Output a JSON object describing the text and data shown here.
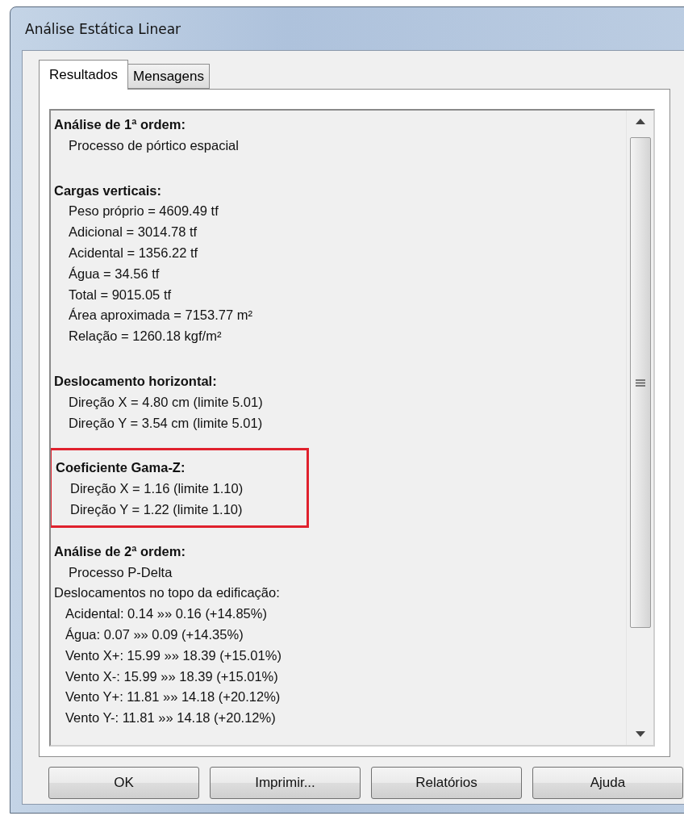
{
  "window": {
    "title": "Análise Estática Linear"
  },
  "tabs": [
    {
      "label": "Resultados",
      "selected": true
    },
    {
      "label": "Mensagens",
      "selected": false
    }
  ],
  "results": {
    "sections": [
      {
        "highlighted": false,
        "lines": [
          {
            "kind": "heading",
            "text": "Análise de 1ª ordem:"
          },
          {
            "kind": "item",
            "text": "Processo de pórtico espacial"
          }
        ]
      },
      {
        "highlighted": false,
        "lines": [
          {
            "kind": "heading",
            "text": "Cargas verticais:"
          },
          {
            "kind": "item",
            "text": "Peso próprio = 4609.49 tf"
          },
          {
            "kind": "item",
            "text": "Adicional = 3014.78 tf"
          },
          {
            "kind": "item",
            "text": "Acidental = 1356.22 tf"
          },
          {
            "kind": "item",
            "text": "Água = 34.56 tf"
          },
          {
            "kind": "item",
            "text": "Total = 9015.05 tf"
          },
          {
            "kind": "item",
            "text": "Área aproximada = 7153.77 m²"
          },
          {
            "kind": "item",
            "text": "Relação = 1260.18 kgf/m²"
          }
        ]
      },
      {
        "highlighted": false,
        "lines": [
          {
            "kind": "heading",
            "text": "Deslocamento horizontal:"
          },
          {
            "kind": "item",
            "text": "Direção X = 4.80 cm (limite 5.01)"
          },
          {
            "kind": "item",
            "text": "Direção Y = 3.54 cm (limite 5.01)"
          }
        ]
      },
      {
        "highlighted": true,
        "lines": [
          {
            "kind": "heading",
            "text": "Coeficiente Gama-Z:"
          },
          {
            "kind": "item",
            "text": "Direção X = 1.16 (limite 1.10)"
          },
          {
            "kind": "item",
            "text": "Direção Y = 1.22 (limite 1.10)"
          }
        ]
      },
      {
        "highlighted": false,
        "lines": [
          {
            "kind": "heading",
            "text": "Análise de 2ª ordem:"
          },
          {
            "kind": "item",
            "text": "Processo P-Delta"
          },
          {
            "kind": "plain",
            "text": "Deslocamentos no topo da edificação:"
          },
          {
            "kind": "subitem",
            "text": "Acidental: 0.14 »» 0.16 (+14.85%)"
          },
          {
            "kind": "subitem",
            "text": "Água: 0.07 »» 0.09 (+14.35%)"
          },
          {
            "kind": "subitem",
            "text": "Vento X+: 15.99 »» 18.39 (+15.01%)"
          },
          {
            "kind": "subitem",
            "text": "Vento X-: 15.99 »» 18.39 (+15.01%)"
          },
          {
            "kind": "subitem",
            "text": "Vento Y+: 11.81 »» 14.18 (+20.12%)"
          },
          {
            "kind": "subitem",
            "text": "Vento Y-: 11.81 »» 14.18 (+20.12%)"
          }
        ]
      }
    ]
  },
  "buttons": [
    "OK",
    "Imprimir...",
    "Relatórios",
    "Ajuda"
  ]
}
